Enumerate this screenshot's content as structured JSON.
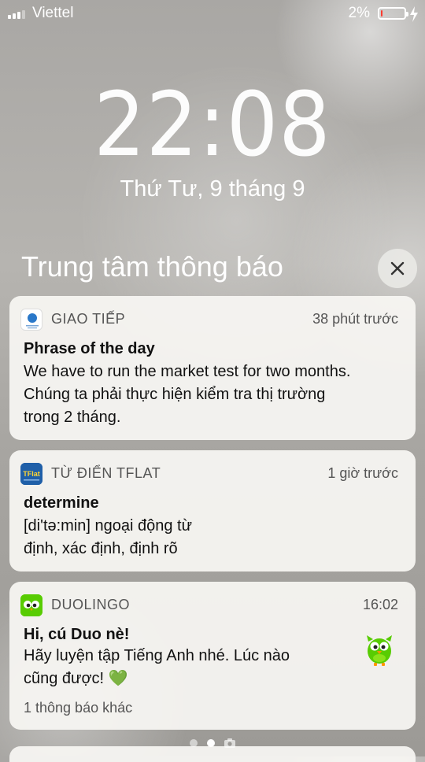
{
  "status_bar": {
    "carrier": "Viettel",
    "battery_percent": "2%",
    "battery_level": 0.05,
    "battery_color": "#ff3b30"
  },
  "lock_screen": {
    "time": "22:08",
    "date": "Thứ Tư, 9 tháng 9"
  },
  "notification_center": {
    "title": "Trung tâm thông báo",
    "close_icon": "close-icon"
  },
  "notifications": [
    {
      "app": "GIAO TIẾP",
      "time": "38 phút trước",
      "icon": "giao-tiep-app-icon",
      "title": "Phrase of the day",
      "body_lines": [
        "We have to run the market test for two months.",
        "Chúng ta phải thực hiện kiểm tra thị trường",
        "trong 2 tháng."
      ]
    },
    {
      "app": "TỪ ĐIỂN TFLAT",
      "time": "1 giờ trước",
      "icon": "tflat-app-icon",
      "icon_text": "TFlat",
      "title": "determine",
      "body_lines": [
        "[di'tə:min] ngoại động từ",
        "định, xác định, định rõ"
      ]
    },
    {
      "app": "DUOLINGO",
      "time": "16:02",
      "icon": "duolingo-app-icon",
      "title": "Hi, cú Duo nè!",
      "body_lines": [
        "Hãy luyện tập Tiếng Anh nhé. Lúc nào",
        "cũng được! 💚"
      ],
      "more": "1 thông báo khác",
      "attachment_icon": "duo-owl-icon"
    }
  ],
  "page_indicator": {
    "pages": 3,
    "active": 2,
    "last_icon": "camera-icon"
  }
}
